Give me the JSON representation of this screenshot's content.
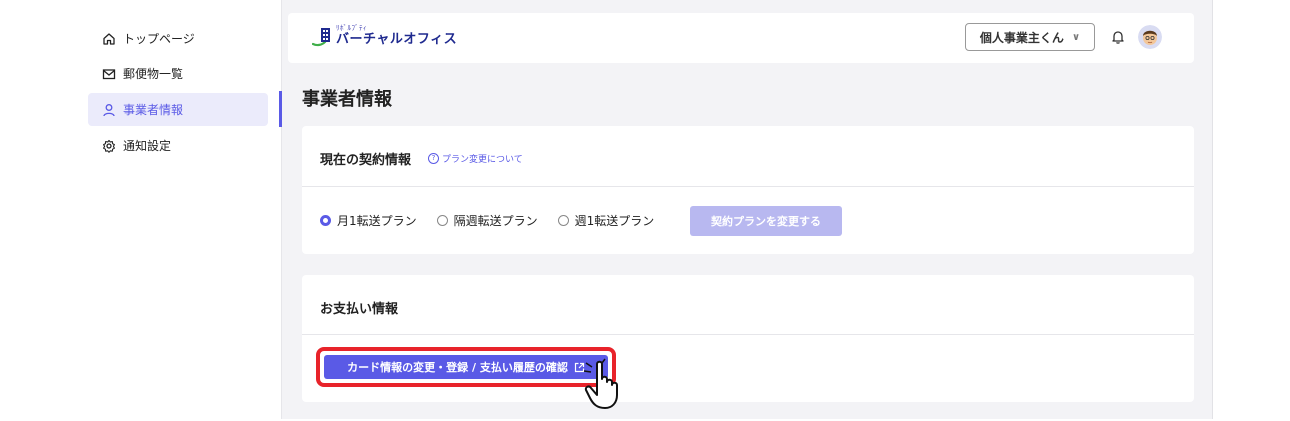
{
  "sidebar": {
    "items": [
      {
        "label": "トップページ",
        "icon": "home-icon"
      },
      {
        "label": "郵便物一覧",
        "icon": "mail-icon"
      },
      {
        "label": "事業者情報",
        "icon": "user-icon",
        "active": true
      },
      {
        "label": "通知設定",
        "icon": "gear-icon"
      }
    ]
  },
  "header": {
    "logo_sub": "ﾘﾎﾞﾙﾌﾞﾃｨ",
    "logo_main": "バーチャルオフィス",
    "user_label": "個人事業主くん",
    "user_chevron": "∨"
  },
  "page": {
    "title": "事業者情報"
  },
  "contract": {
    "title": "現在の契約情報",
    "help_link": "プラン変更について",
    "options": [
      "月1転送プラン",
      "隔週転送プラン",
      "週1転送プラン"
    ],
    "selected_index": 0,
    "change_button": "契約プランを変更する"
  },
  "payment": {
    "title": "お支払い情報",
    "button": "カード情報の変更・登録 / 支払い履歴の確認"
  },
  "colors": {
    "accent": "#5a5ae6",
    "accent_light": "#b8b8f0",
    "highlight": "#e8232a",
    "background": "#f3f3f6"
  }
}
